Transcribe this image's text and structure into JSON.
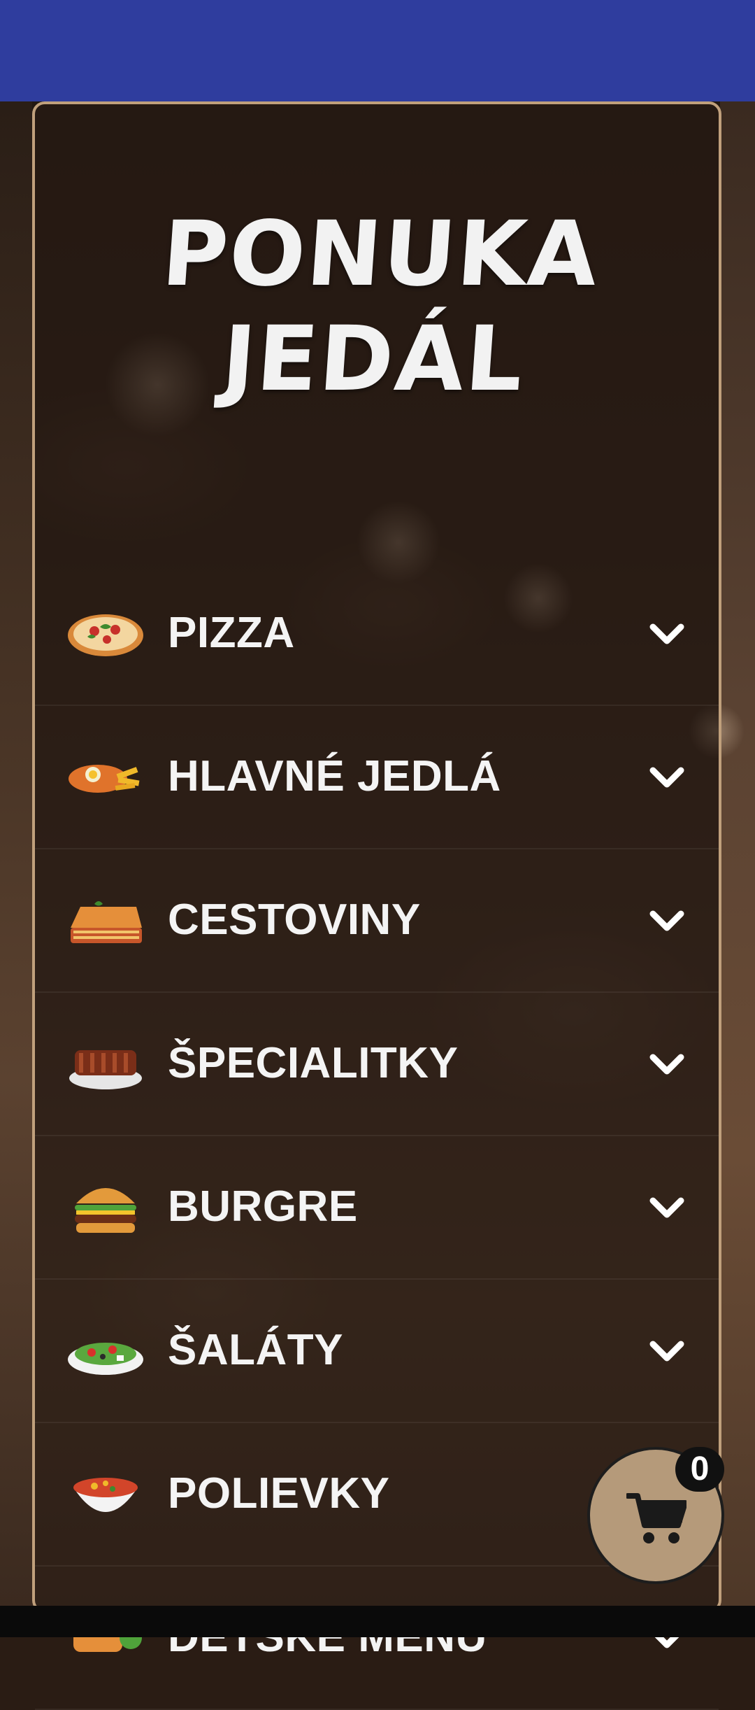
{
  "header": {
    "color": "#2f3d9e"
  },
  "menu": {
    "title_line1": "PONUKA",
    "title_line2": "JEDÁL",
    "items": [
      {
        "label": "PIZZA",
        "icon": "pizza-icon"
      },
      {
        "label": "HLAVNÉ JEDLÁ",
        "icon": "main-dish-icon"
      },
      {
        "label": "CESTOVINY",
        "icon": "lasagna-icon"
      },
      {
        "label": "ŠPECIALITKY",
        "icon": "ribs-icon"
      },
      {
        "label": "BURGRE",
        "icon": "burger-icon"
      },
      {
        "label": "ŠALÁTY",
        "icon": "salad-icon"
      },
      {
        "label": "POLIEVKY",
        "icon": "soup-icon"
      },
      {
        "label": "DETSKÉ MENU",
        "icon": "kids-menu-icon"
      }
    ]
  },
  "cart": {
    "count": "0",
    "icon": "cart-icon"
  },
  "colors": {
    "panel_border": "#c0a07c",
    "cart_bg": "#b59a7a",
    "text": "#f4f4f4"
  }
}
